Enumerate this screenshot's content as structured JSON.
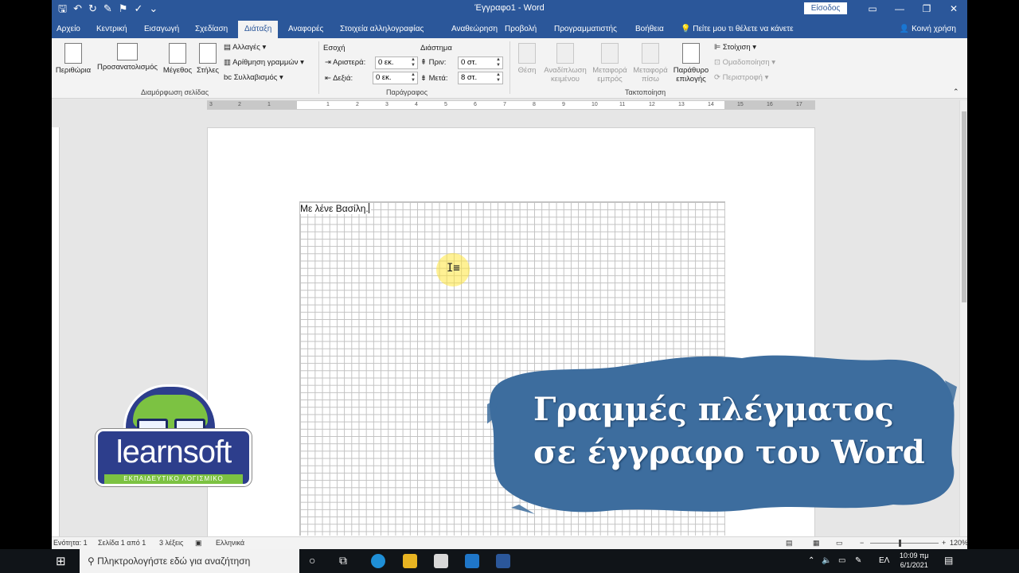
{
  "window": {
    "title": "Έγγραφο1 - Word",
    "signin": "Είσοδος"
  },
  "tabs": [
    "Αρχείο",
    "Κεντρική",
    "Εισαγωγή",
    "Σχεδίαση",
    "Διάταξη",
    "Αναφορές",
    "Στοιχεία αλληλογραφίας",
    "Αναθεώρηση",
    "Προβολή",
    "Προγραμματιστής",
    "Βοήθεια"
  ],
  "tell_me": "Πείτε μου τι θέλετε να κάνετε",
  "share": "Κοινή χρήση",
  "ribbon": {
    "page_setup": {
      "margins": "Περιθώρια",
      "orientation": "Προσανατολισμός",
      "size": "Μέγεθος",
      "columns": "Στήλες",
      "breaks": "Αλλαγές",
      "line_numbers": "Αρίθμηση γραμμών",
      "hyphenation": "Συλλαβισμός",
      "label": "Διαμόρφωση σελίδας"
    },
    "paragraph": {
      "indent": "Εσοχή",
      "spacing": "Διάστημα",
      "left_label": "Αριστερά:",
      "left_value": "0 εκ.",
      "right_label": "Δεξιά:",
      "right_value": "0 εκ.",
      "before_label": "Πριν:",
      "before_value": "0 στ.",
      "after_label": "Μετά:",
      "after_value": "8 στ.",
      "label": "Παράγραφος"
    },
    "arrange": {
      "position": "Θέση",
      "wrap_1": "Αναδίπλωση",
      "wrap_2": "κειμένου",
      "forward_1": "Μεταφορά",
      "forward_2": "εμπρός",
      "backward_1": "Μεταφορά",
      "backward_2": "πίσω",
      "pane_1": "Παράθυρο",
      "pane_2": "επιλογής",
      "align": "Στοίχιση",
      "group": "Ομαδοποίηση",
      "rotate": "Περιστροφή",
      "label": "Τακτοποίηση"
    }
  },
  "ruler_numbers": [
    "3",
    "2",
    "1",
    "1",
    "2",
    "3",
    "4",
    "5",
    "6",
    "7",
    "8",
    "9",
    "10",
    "11",
    "12",
    "13",
    "14",
    "15",
    "16",
    "17"
  ],
  "document": {
    "text": "Με λένε Βασίλη."
  },
  "status": {
    "section": "Ενότητα: 1",
    "page": "Σελίδα 1 από 1",
    "words": "3 λέξεις",
    "language": "Ελληνικά",
    "zoom": "120%"
  },
  "taskbar": {
    "search": "Πληκτρολογήστε εδώ για αναζήτηση",
    "lang": "ΕΛ",
    "time": "10:09 πμ",
    "date": "6/1/2021"
  },
  "logo": {
    "name": "learnsoft",
    "tagline": "ΕΚΠΑΙΔΕΥΤΙΚΟ ΛΟΓΙΣΜΙΚΟ"
  },
  "banner": {
    "line1": "Γραμμές πλέγματος",
    "line2": "σε έγγραφο του Word"
  },
  "colors": {
    "word_blue": "#2b579a",
    "banner_blue": "#3d6d9e",
    "logo_navy": "#2d3e8c",
    "logo_green": "#7cc242"
  }
}
